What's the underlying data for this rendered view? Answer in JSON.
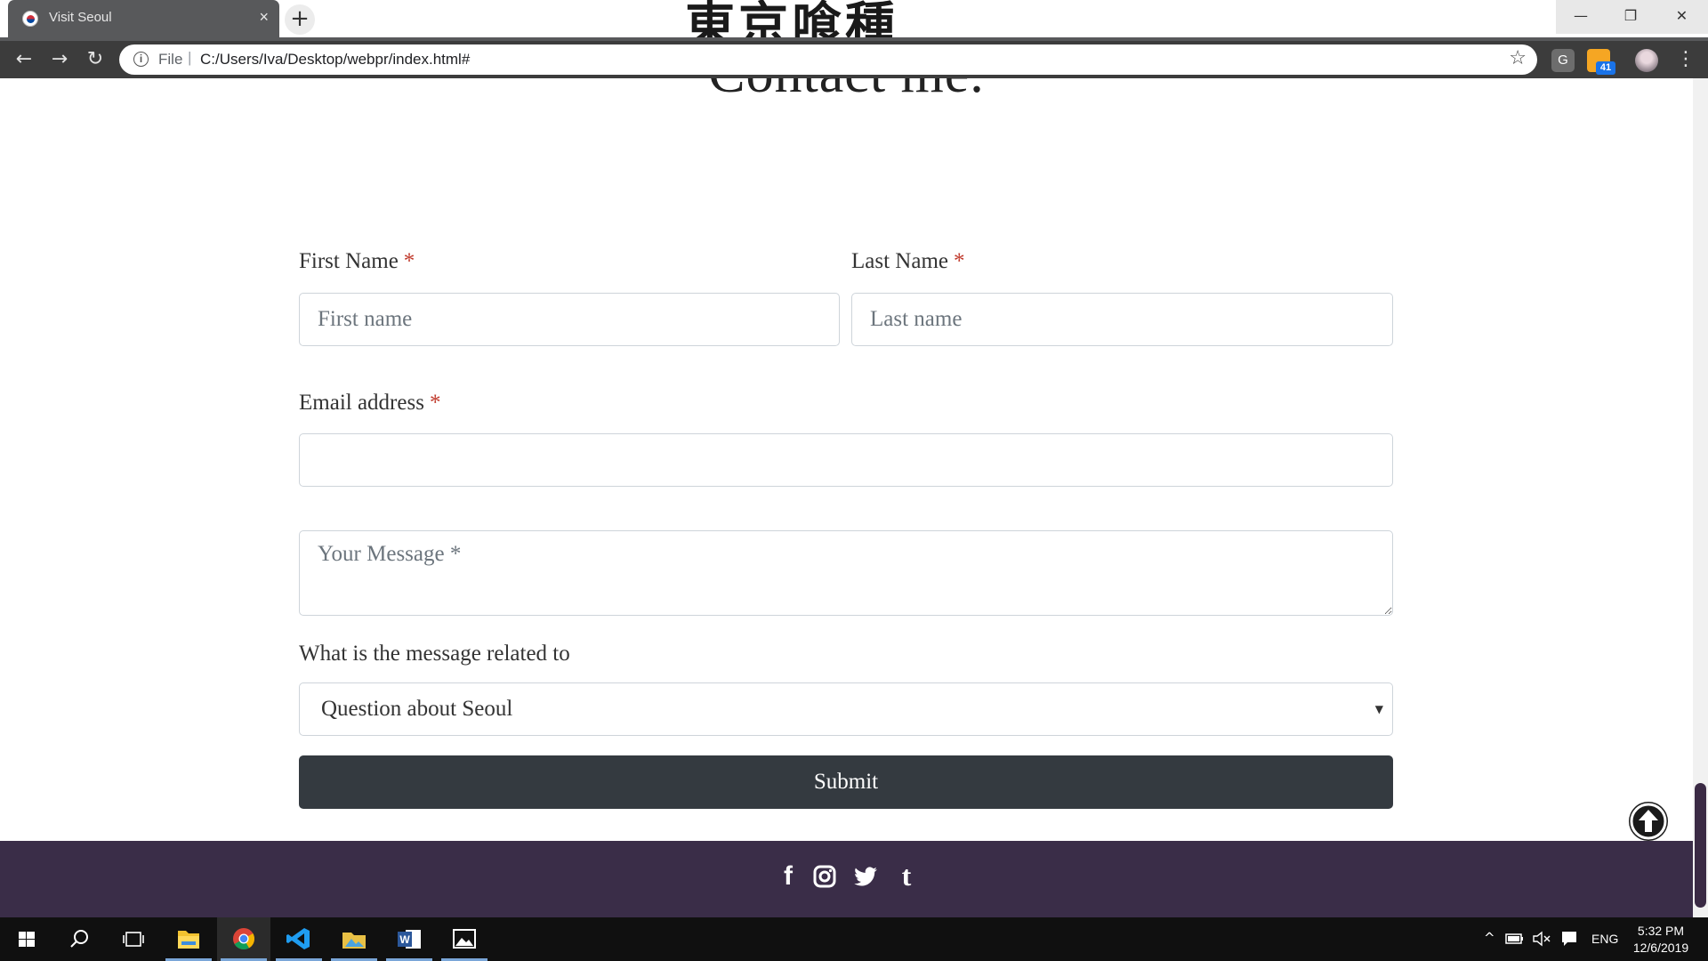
{
  "browser": {
    "tab_title": "Visit Seoul",
    "tab_close": "×",
    "new_tab": "+",
    "banner_glyphs": "東京喰種",
    "url_scheme": "File",
    "url_separator": "|",
    "url": "C:/Users/Iva/Desktop/webpr/index.html#",
    "extension_badge": "41",
    "window_controls": {
      "minimize": "—",
      "restore": "❐",
      "close": "✕"
    },
    "nav": {
      "back": "←",
      "forward": "→",
      "reload": "↻"
    },
    "menu": "⋮"
  },
  "page": {
    "heading": "Contact me.",
    "form": {
      "first_name_label": "First Name",
      "first_name_placeholder": "First name",
      "last_name_label": "Last Name",
      "last_name_placeholder": "Last name",
      "required_marker": "*",
      "email_label": "Email address",
      "email_value": "",
      "message_placeholder": "Your Message *",
      "topic_label": "What is the message related to",
      "topic_selected": "Question about Seoul",
      "submit_label": "Submit"
    },
    "footer": {
      "social_icons": [
        "facebook-icon",
        "instagram-icon",
        "twitter-icon",
        "tumblr-icon"
      ],
      "facebook_glyph": "f",
      "tumblr_glyph": "t"
    }
  },
  "taskbar": {
    "language": "ENG",
    "time": "5:32 PM",
    "date": "12/6/2019",
    "apps": [
      "windows-start",
      "search",
      "task-view",
      "file-explorer",
      "chrome",
      "vscode",
      "photos-folder",
      "word",
      "photos"
    ]
  },
  "colors": {
    "footer_bg": "#3a2d48",
    "submit_bg": "#343a40",
    "required": "#c0392b"
  }
}
